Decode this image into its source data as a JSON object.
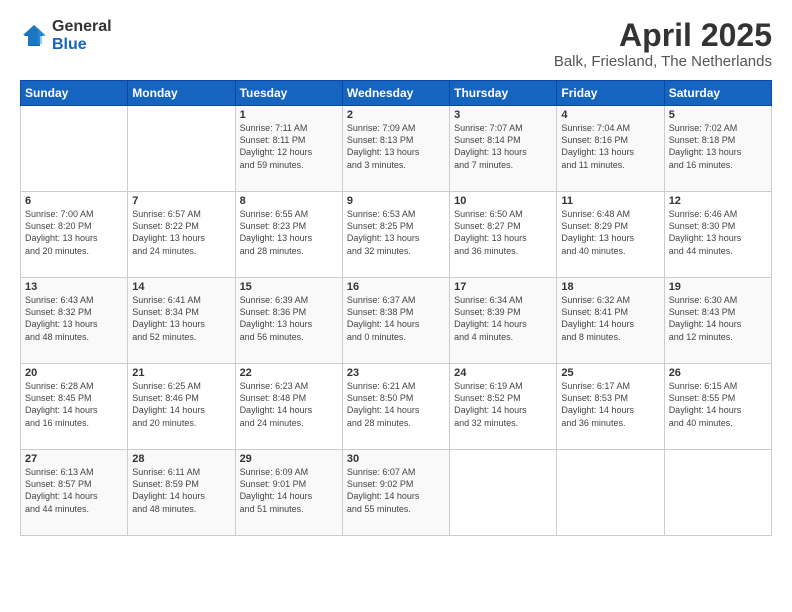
{
  "logo": {
    "general": "General",
    "blue": "Blue"
  },
  "header": {
    "title": "April 2025",
    "subtitle": "Balk, Friesland, The Netherlands"
  },
  "days_of_week": [
    "Sunday",
    "Monday",
    "Tuesday",
    "Wednesday",
    "Thursday",
    "Friday",
    "Saturday"
  ],
  "weeks": [
    [
      {
        "day": "",
        "info": ""
      },
      {
        "day": "",
        "info": ""
      },
      {
        "day": "1",
        "info": "Sunrise: 7:11 AM\nSunset: 8:11 PM\nDaylight: 12 hours\nand 59 minutes."
      },
      {
        "day": "2",
        "info": "Sunrise: 7:09 AM\nSunset: 8:13 PM\nDaylight: 13 hours\nand 3 minutes."
      },
      {
        "day": "3",
        "info": "Sunrise: 7:07 AM\nSunset: 8:14 PM\nDaylight: 13 hours\nand 7 minutes."
      },
      {
        "day": "4",
        "info": "Sunrise: 7:04 AM\nSunset: 8:16 PM\nDaylight: 13 hours\nand 11 minutes."
      },
      {
        "day": "5",
        "info": "Sunrise: 7:02 AM\nSunset: 8:18 PM\nDaylight: 13 hours\nand 16 minutes."
      }
    ],
    [
      {
        "day": "6",
        "info": "Sunrise: 7:00 AM\nSunset: 8:20 PM\nDaylight: 13 hours\nand 20 minutes."
      },
      {
        "day": "7",
        "info": "Sunrise: 6:57 AM\nSunset: 8:22 PM\nDaylight: 13 hours\nand 24 minutes."
      },
      {
        "day": "8",
        "info": "Sunrise: 6:55 AM\nSunset: 8:23 PM\nDaylight: 13 hours\nand 28 minutes."
      },
      {
        "day": "9",
        "info": "Sunrise: 6:53 AM\nSunset: 8:25 PM\nDaylight: 13 hours\nand 32 minutes."
      },
      {
        "day": "10",
        "info": "Sunrise: 6:50 AM\nSunset: 8:27 PM\nDaylight: 13 hours\nand 36 minutes."
      },
      {
        "day": "11",
        "info": "Sunrise: 6:48 AM\nSunset: 8:29 PM\nDaylight: 13 hours\nand 40 minutes."
      },
      {
        "day": "12",
        "info": "Sunrise: 6:46 AM\nSunset: 8:30 PM\nDaylight: 13 hours\nand 44 minutes."
      }
    ],
    [
      {
        "day": "13",
        "info": "Sunrise: 6:43 AM\nSunset: 8:32 PM\nDaylight: 13 hours\nand 48 minutes."
      },
      {
        "day": "14",
        "info": "Sunrise: 6:41 AM\nSunset: 8:34 PM\nDaylight: 13 hours\nand 52 minutes."
      },
      {
        "day": "15",
        "info": "Sunrise: 6:39 AM\nSunset: 8:36 PM\nDaylight: 13 hours\nand 56 minutes."
      },
      {
        "day": "16",
        "info": "Sunrise: 6:37 AM\nSunset: 8:38 PM\nDaylight: 14 hours\nand 0 minutes."
      },
      {
        "day": "17",
        "info": "Sunrise: 6:34 AM\nSunset: 8:39 PM\nDaylight: 14 hours\nand 4 minutes."
      },
      {
        "day": "18",
        "info": "Sunrise: 6:32 AM\nSunset: 8:41 PM\nDaylight: 14 hours\nand 8 minutes."
      },
      {
        "day": "19",
        "info": "Sunrise: 6:30 AM\nSunset: 8:43 PM\nDaylight: 14 hours\nand 12 minutes."
      }
    ],
    [
      {
        "day": "20",
        "info": "Sunrise: 6:28 AM\nSunset: 8:45 PM\nDaylight: 14 hours\nand 16 minutes."
      },
      {
        "day": "21",
        "info": "Sunrise: 6:25 AM\nSunset: 8:46 PM\nDaylight: 14 hours\nand 20 minutes."
      },
      {
        "day": "22",
        "info": "Sunrise: 6:23 AM\nSunset: 8:48 PM\nDaylight: 14 hours\nand 24 minutes."
      },
      {
        "day": "23",
        "info": "Sunrise: 6:21 AM\nSunset: 8:50 PM\nDaylight: 14 hours\nand 28 minutes."
      },
      {
        "day": "24",
        "info": "Sunrise: 6:19 AM\nSunset: 8:52 PM\nDaylight: 14 hours\nand 32 minutes."
      },
      {
        "day": "25",
        "info": "Sunrise: 6:17 AM\nSunset: 8:53 PM\nDaylight: 14 hours\nand 36 minutes."
      },
      {
        "day": "26",
        "info": "Sunrise: 6:15 AM\nSunset: 8:55 PM\nDaylight: 14 hours\nand 40 minutes."
      }
    ],
    [
      {
        "day": "27",
        "info": "Sunrise: 6:13 AM\nSunset: 8:57 PM\nDaylight: 14 hours\nand 44 minutes."
      },
      {
        "day": "28",
        "info": "Sunrise: 6:11 AM\nSunset: 8:59 PM\nDaylight: 14 hours\nand 48 minutes."
      },
      {
        "day": "29",
        "info": "Sunrise: 6:09 AM\nSunset: 9:01 PM\nDaylight: 14 hours\nand 51 minutes."
      },
      {
        "day": "30",
        "info": "Sunrise: 6:07 AM\nSunset: 9:02 PM\nDaylight: 14 hours\nand 55 minutes."
      },
      {
        "day": "",
        "info": ""
      },
      {
        "day": "",
        "info": ""
      },
      {
        "day": "",
        "info": ""
      }
    ]
  ]
}
